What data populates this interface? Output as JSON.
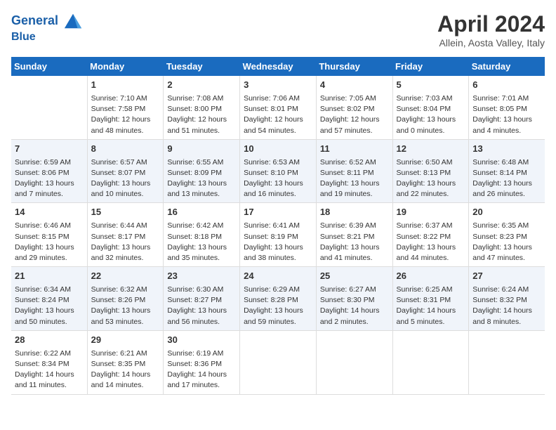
{
  "header": {
    "logo_line1": "General",
    "logo_line2": "Blue",
    "month": "April 2024",
    "location": "Allein, Aosta Valley, Italy"
  },
  "days_of_week": [
    "Sunday",
    "Monday",
    "Tuesday",
    "Wednesday",
    "Thursday",
    "Friday",
    "Saturday"
  ],
  "weeks": [
    [
      {
        "day": "",
        "info": ""
      },
      {
        "day": "1",
        "info": "Sunrise: 7:10 AM\nSunset: 7:58 PM\nDaylight: 12 hours\nand 48 minutes."
      },
      {
        "day": "2",
        "info": "Sunrise: 7:08 AM\nSunset: 8:00 PM\nDaylight: 12 hours\nand 51 minutes."
      },
      {
        "day": "3",
        "info": "Sunrise: 7:06 AM\nSunset: 8:01 PM\nDaylight: 12 hours\nand 54 minutes."
      },
      {
        "day": "4",
        "info": "Sunrise: 7:05 AM\nSunset: 8:02 PM\nDaylight: 12 hours\nand 57 minutes."
      },
      {
        "day": "5",
        "info": "Sunrise: 7:03 AM\nSunset: 8:04 PM\nDaylight: 13 hours\nand 0 minutes."
      },
      {
        "day": "6",
        "info": "Sunrise: 7:01 AM\nSunset: 8:05 PM\nDaylight: 13 hours\nand 4 minutes."
      }
    ],
    [
      {
        "day": "7",
        "info": "Sunrise: 6:59 AM\nSunset: 8:06 PM\nDaylight: 13 hours\nand 7 minutes."
      },
      {
        "day": "8",
        "info": "Sunrise: 6:57 AM\nSunset: 8:07 PM\nDaylight: 13 hours\nand 10 minutes."
      },
      {
        "day": "9",
        "info": "Sunrise: 6:55 AM\nSunset: 8:09 PM\nDaylight: 13 hours\nand 13 minutes."
      },
      {
        "day": "10",
        "info": "Sunrise: 6:53 AM\nSunset: 8:10 PM\nDaylight: 13 hours\nand 16 minutes."
      },
      {
        "day": "11",
        "info": "Sunrise: 6:52 AM\nSunset: 8:11 PM\nDaylight: 13 hours\nand 19 minutes."
      },
      {
        "day": "12",
        "info": "Sunrise: 6:50 AM\nSunset: 8:13 PM\nDaylight: 13 hours\nand 22 minutes."
      },
      {
        "day": "13",
        "info": "Sunrise: 6:48 AM\nSunset: 8:14 PM\nDaylight: 13 hours\nand 26 minutes."
      }
    ],
    [
      {
        "day": "14",
        "info": "Sunrise: 6:46 AM\nSunset: 8:15 PM\nDaylight: 13 hours\nand 29 minutes."
      },
      {
        "day": "15",
        "info": "Sunrise: 6:44 AM\nSunset: 8:17 PM\nDaylight: 13 hours\nand 32 minutes."
      },
      {
        "day": "16",
        "info": "Sunrise: 6:42 AM\nSunset: 8:18 PM\nDaylight: 13 hours\nand 35 minutes."
      },
      {
        "day": "17",
        "info": "Sunrise: 6:41 AM\nSunset: 8:19 PM\nDaylight: 13 hours\nand 38 minutes."
      },
      {
        "day": "18",
        "info": "Sunrise: 6:39 AM\nSunset: 8:21 PM\nDaylight: 13 hours\nand 41 minutes."
      },
      {
        "day": "19",
        "info": "Sunrise: 6:37 AM\nSunset: 8:22 PM\nDaylight: 13 hours\nand 44 minutes."
      },
      {
        "day": "20",
        "info": "Sunrise: 6:35 AM\nSunset: 8:23 PM\nDaylight: 13 hours\nand 47 minutes."
      }
    ],
    [
      {
        "day": "21",
        "info": "Sunrise: 6:34 AM\nSunset: 8:24 PM\nDaylight: 13 hours\nand 50 minutes."
      },
      {
        "day": "22",
        "info": "Sunrise: 6:32 AM\nSunset: 8:26 PM\nDaylight: 13 hours\nand 53 minutes."
      },
      {
        "day": "23",
        "info": "Sunrise: 6:30 AM\nSunset: 8:27 PM\nDaylight: 13 hours\nand 56 minutes."
      },
      {
        "day": "24",
        "info": "Sunrise: 6:29 AM\nSunset: 8:28 PM\nDaylight: 13 hours\nand 59 minutes."
      },
      {
        "day": "25",
        "info": "Sunrise: 6:27 AM\nSunset: 8:30 PM\nDaylight: 14 hours\nand 2 minutes."
      },
      {
        "day": "26",
        "info": "Sunrise: 6:25 AM\nSunset: 8:31 PM\nDaylight: 14 hours\nand 5 minutes."
      },
      {
        "day": "27",
        "info": "Sunrise: 6:24 AM\nSunset: 8:32 PM\nDaylight: 14 hours\nand 8 minutes."
      }
    ],
    [
      {
        "day": "28",
        "info": "Sunrise: 6:22 AM\nSunset: 8:34 PM\nDaylight: 14 hours\nand 11 minutes."
      },
      {
        "day": "29",
        "info": "Sunrise: 6:21 AM\nSunset: 8:35 PM\nDaylight: 14 hours\nand 14 minutes."
      },
      {
        "day": "30",
        "info": "Sunrise: 6:19 AM\nSunset: 8:36 PM\nDaylight: 14 hours\nand 17 minutes."
      },
      {
        "day": "",
        "info": ""
      },
      {
        "day": "",
        "info": ""
      },
      {
        "day": "",
        "info": ""
      },
      {
        "day": "",
        "info": ""
      }
    ]
  ]
}
